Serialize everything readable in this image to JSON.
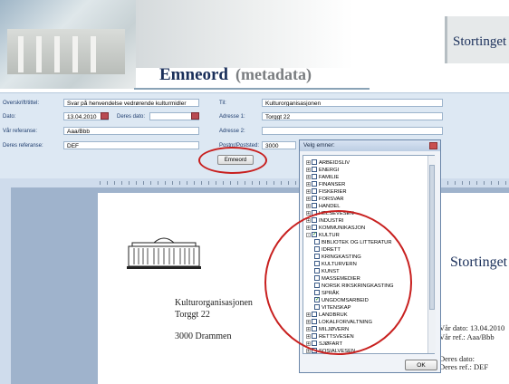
{
  "header": {
    "title": "Emneord",
    "subtitle": "(metadata)",
    "logo_text": "Stortinget"
  },
  "form": {
    "overskrift_label": "Overskrift/tittel:",
    "overskrift_value": "Svar på henvendelse vedrørende kulturmidler",
    "dato_label": "Dato:",
    "dato_value": "13.04.2010",
    "deres_dato_label": "Deres dato:",
    "var_ref_label": "Vår referanse:",
    "var_ref_value": "Aaa/Bbb",
    "deres_ref_label": "Deres referanse:",
    "deres_ref_value": "DEF",
    "til_label": "Til:",
    "til_value": "Kulturorganisasjonen",
    "adresse1_label": "Adresse 1:",
    "adresse1_value": "Torggt 22",
    "adresse2_label": "Adresse 2:",
    "postnr_label": "Postnr/Poststed:",
    "postnr_value": "3000",
    "emneord_button": "Emneord"
  },
  "document": {
    "recipient_name": "Kulturorganisasjonen",
    "recipient_street": "Torggt 22",
    "recipient_city": "3000 Drammen",
    "logo_text": "Stortinget",
    "var_dato": "Vår dato: 13.04.2010",
    "var_ref": "Vår ref.: Aaa/Bbb",
    "deres_dato": "Deres dato:",
    "deres_ref": "Deres ref.: DEF"
  },
  "dialog": {
    "title": "Velg emner:",
    "ok_label": "OK",
    "items": [
      {
        "label": "ARBEIDSLIV",
        "level": 0,
        "expander": "+",
        "checked": false
      },
      {
        "label": "ENERGI",
        "level": 0,
        "expander": "+",
        "checked": false
      },
      {
        "label": "FAMILIE",
        "level": 0,
        "expander": "+",
        "checked": false
      },
      {
        "label": "FINANSER",
        "level": 0,
        "expander": "+",
        "checked": false
      },
      {
        "label": "FISKERIER",
        "level": 0,
        "expander": "+",
        "checked": false
      },
      {
        "label": "FORSVAR",
        "level": 0,
        "expander": "+",
        "checked": false
      },
      {
        "label": "HANDEL",
        "level": 0,
        "expander": "+",
        "checked": false
      },
      {
        "label": "HELSEVESEN",
        "level": 0,
        "expander": "+",
        "checked": false
      },
      {
        "label": "INDUSTRI",
        "level": 0,
        "expander": "+",
        "checked": false
      },
      {
        "label": "KOMMUNIKASJON",
        "level": 0,
        "expander": "+",
        "checked": false
      },
      {
        "label": "KULTUR",
        "level": 0,
        "expander": "-",
        "checked": true
      },
      {
        "label": "BIBLIOTEK OG LITTERATUR",
        "level": 1,
        "expander": "",
        "checked": false
      },
      {
        "label": "IDRETT",
        "level": 1,
        "expander": "",
        "checked": false
      },
      {
        "label": "KRINGKASTING",
        "level": 1,
        "expander": "",
        "checked": false
      },
      {
        "label": "KULTURVERN",
        "level": 1,
        "expander": "",
        "checked": false
      },
      {
        "label": "KUNST",
        "level": 1,
        "expander": "",
        "checked": false
      },
      {
        "label": "MASSEMEDIER",
        "level": 1,
        "expander": "",
        "checked": false
      },
      {
        "label": "NORSK RIKSKRINGKASTING",
        "level": 1,
        "expander": "",
        "checked": false
      },
      {
        "label": "SPRÅK",
        "level": 1,
        "expander": "",
        "checked": false
      },
      {
        "label": "UNGDOMSARBEID",
        "level": 1,
        "expander": "",
        "checked": true
      },
      {
        "label": "VITENSKAP",
        "level": 1,
        "expander": "",
        "checked": false
      },
      {
        "label": "LANDBRUK",
        "level": 0,
        "expander": "+",
        "checked": false
      },
      {
        "label": "LOKALFORVALTNING",
        "level": 0,
        "expander": "+",
        "checked": false
      },
      {
        "label": "MILJØVERN",
        "level": 0,
        "expander": "+",
        "checked": false
      },
      {
        "label": "RETTSVESEN",
        "level": 0,
        "expander": "+",
        "checked": false
      },
      {
        "label": "SJØFART",
        "level": 0,
        "expander": "+",
        "checked": false
      },
      {
        "label": "SOSIALVESEN",
        "level": 0,
        "expander": "+",
        "checked": false
      }
    ]
  },
  "colors": {
    "title": "#1a2f5a",
    "highlight_circle": "#c8201f",
    "form_background": "#dde8f3"
  }
}
